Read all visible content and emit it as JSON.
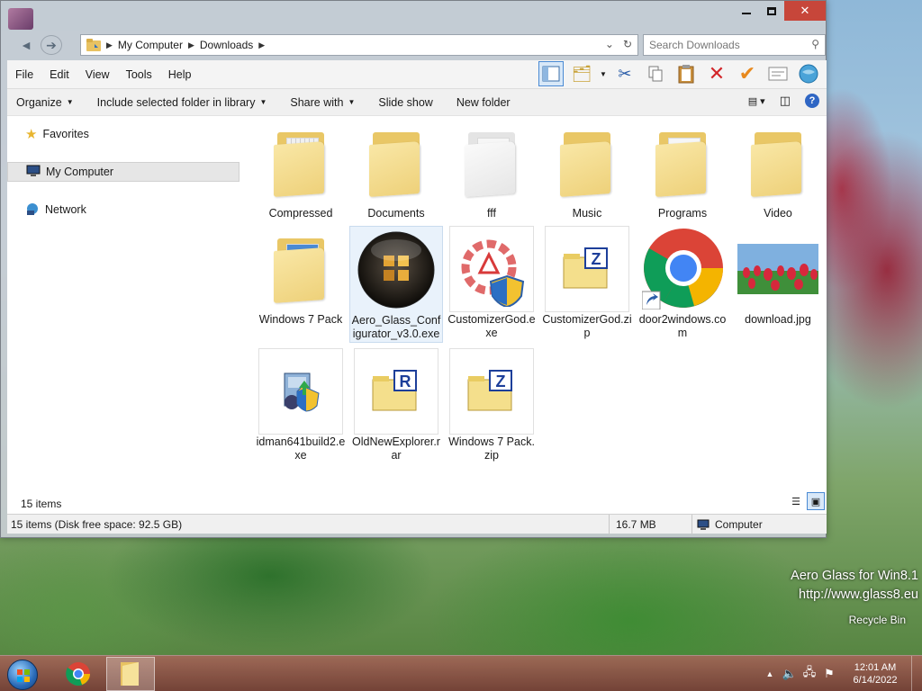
{
  "window": {
    "caption": {
      "min": "",
      "max": "",
      "close": "✕"
    }
  },
  "address": {
    "crumbs": [
      "My Computer",
      "Downloads"
    ],
    "search_placeholder": "Search Downloads"
  },
  "menu": [
    "File",
    "Edit",
    "View",
    "Tools",
    "Help"
  ],
  "commands": {
    "organize": "Organize",
    "include": "Include selected folder in library",
    "share": "Share with",
    "slideshow": "Slide show",
    "newfolder": "New folder"
  },
  "navpane": {
    "favorites": "Favorites",
    "mycomputer": "My Computer",
    "network": "Network"
  },
  "items": [
    {
      "label": "Compressed",
      "icon": "folder-zip-icon"
    },
    {
      "label": "Documents",
      "icon": "folder-icon"
    },
    {
      "label": "fff",
      "icon": "folder-open-icon"
    },
    {
      "label": "Music",
      "icon": "folder-icon"
    },
    {
      "label": "Programs",
      "icon": "folder-icon"
    },
    {
      "label": "Video",
      "icon": "folder-icon"
    },
    {
      "label": "Windows 7 Pack",
      "icon": "folder-icon"
    },
    {
      "label": "Aero_Glass_Configurator_v3.0.exe",
      "icon": "aero-orb-icon"
    },
    {
      "label": "CustomizerGod.exe",
      "icon": "gear-shield-icon"
    },
    {
      "label": "CustomizerGod.zip",
      "icon": "zip-icon"
    },
    {
      "label": "door2windows.com",
      "icon": "chrome-shortcut-icon"
    },
    {
      "label": "download.jpg",
      "icon": "tulip-image-icon"
    },
    {
      "label": "idman641build2.exe",
      "icon": "installer-icon"
    },
    {
      "label": "OldNewExplorer.rar",
      "icon": "rar-icon"
    },
    {
      "label": "Windows 7 Pack.zip",
      "icon": "zip-icon"
    }
  ],
  "content_footer": {
    "count": "15 items"
  },
  "status": {
    "left": "15 items (Disk free space: 92.5 GB)",
    "size": "16.7 MB",
    "location": "Computer"
  },
  "desktop": {
    "watermark_line1": "Aero Glass for Win8.1",
    "watermark_line2": "http://www.glass8.eu",
    "recycle_bin": "Recycle Bin"
  },
  "clock": {
    "time": "12:01 AM",
    "date": "6/14/2022"
  }
}
